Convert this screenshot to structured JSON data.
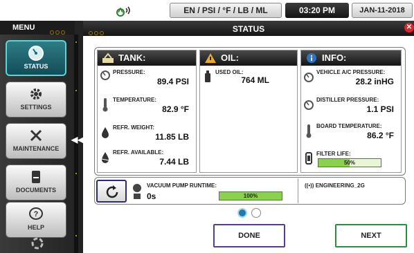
{
  "topbar": {
    "units": "EN / PSI / °F / LB / ML",
    "time": "03:20 PM",
    "date": "JAN-11-2018"
  },
  "sidebar": {
    "title": "MENU",
    "items": [
      {
        "label": "STATUS",
        "icon": "gauge-icon",
        "active": true
      },
      {
        "label": "SETTINGS",
        "icon": "gear-icon",
        "active": false
      },
      {
        "label": "MAINTENANCE",
        "icon": "tools-icon",
        "active": false
      },
      {
        "label": "DOCUMENTS",
        "icon": "document-icon",
        "active": false
      },
      {
        "label": "HELP",
        "icon": "help-icon",
        "active": false
      }
    ]
  },
  "window": {
    "title": "STATUS"
  },
  "tank": {
    "header": "TANK:",
    "items": [
      {
        "label": "PRESSURE:",
        "value": "89.4 PSI",
        "icon": "gauge-icon"
      },
      {
        "label": "TEMPERATURE:",
        "value": "82.9 °F",
        "icon": "thermometer-icon"
      },
      {
        "label": "REFR. WEIGHT:",
        "value": "11.85 LB",
        "icon": "drop-icon"
      },
      {
        "label": "REFR. AVAILABLE:",
        "value": "7.44 LB",
        "icon": "drop-level-icon"
      }
    ]
  },
  "oil": {
    "header": "OIL:",
    "items": [
      {
        "label": "USED OIL:",
        "value": "764 ML",
        "icon": "oil-bottle-icon"
      }
    ]
  },
  "info": {
    "header": "INFO:",
    "items": [
      {
        "label": "VEHICLE A/C PRESSURE:",
        "value": "28.2 inHG",
        "icon": "gauge-icon"
      },
      {
        "label": "DISTILLER PRESSURE:",
        "value": "1.1 PSI",
        "icon": "gauge-icon"
      },
      {
        "label": "BOARD TEMPERATURE:",
        "value": "86.2 °F",
        "icon": "thermometer-icon"
      }
    ],
    "filter": {
      "label": "FILTER LIFE:",
      "value": 0.5,
      "text": "50%"
    }
  },
  "pump": {
    "label": "VACUUM PUMP RUNTIME:",
    "value": "0s",
    "progress": 1.0,
    "progress_text": "100%"
  },
  "network": {
    "ssid": "ENGINEERING_2G"
  },
  "pager": {
    "current": 1,
    "total": 2
  },
  "buttons": {
    "done": "DONE",
    "next": "NEXT"
  },
  "colors": {
    "active_tab": "#1b6a74",
    "progress_fill": "#8ad14e",
    "close": "#d8262d",
    "done_border": "#5b3a86",
    "next_border": "#2e8a3e"
  }
}
